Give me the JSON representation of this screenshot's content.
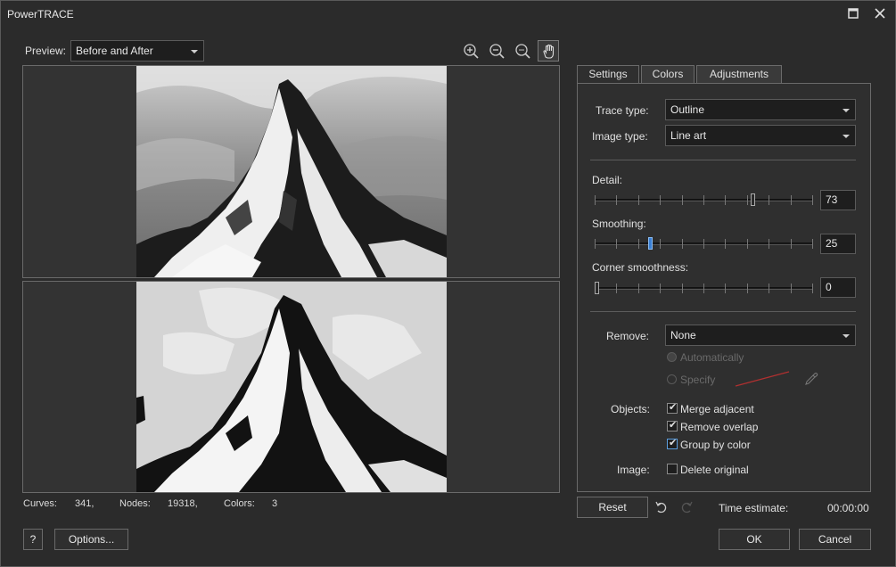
{
  "window": {
    "title": "PowerTRACE",
    "maximize_icon": "maximize-icon",
    "close_icon": "close-icon"
  },
  "preview": {
    "label": "Preview:",
    "value": "Before and After"
  },
  "zoom_tools": [
    "zoom-in-icon",
    "zoom-out-icon",
    "zoom-fit-icon",
    "pan-hand-icon"
  ],
  "tabs": [
    {
      "label": "Settings",
      "active": true
    },
    {
      "label": "Colors",
      "active": false
    },
    {
      "label": "Adjustments",
      "active": false
    }
  ],
  "settings": {
    "trace_type_label": "Trace type:",
    "trace_type_value": "Outline",
    "image_type_label": "Image type:",
    "image_type_value": "Line art",
    "detail_label": "Detail:",
    "detail_value": "73",
    "detail_fraction": 0.73,
    "smoothing_label": "Smoothing:",
    "smoothing_value": "25",
    "smoothing_fraction": 0.25,
    "corner_label": "Corner smoothness:",
    "corner_value": "0",
    "corner_fraction": 0.0,
    "remove_label": "Remove:",
    "remove_value": "None",
    "automatically_label": "Automatically",
    "specify_label": "Specify",
    "objects_label": "Objects:",
    "merge_adjacent_label": "Merge adjacent",
    "remove_overlap_label": "Remove overlap",
    "group_by_color_label": "Group by color",
    "image_label": "Image:",
    "delete_original_label": "Delete original"
  },
  "status": {
    "curves_label": "Curves:",
    "curves_value": "341,",
    "nodes_label": "Nodes:",
    "nodes_value": "19318,",
    "colors_label": "Colors:",
    "colors_value": "3"
  },
  "footer": {
    "help_label": "?",
    "options_label": "Options...",
    "reset_label": "Reset",
    "time_estimate_label": "Time estimate:",
    "time_estimate_value": "00:00:00",
    "ok_label": "OK",
    "cancel_label": "Cancel"
  }
}
